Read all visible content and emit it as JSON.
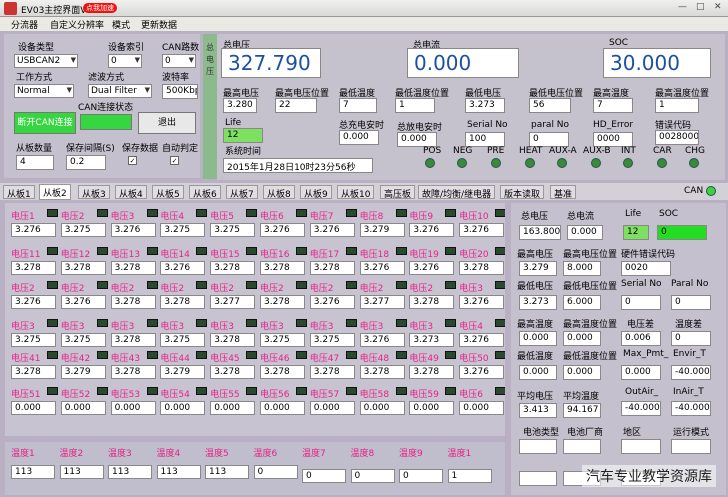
{
  "window": {
    "title": "EV03主控界面V1.5",
    "badge": "点我加速"
  },
  "menu": [
    "分流器",
    "自定义分辨率",
    "模式",
    "更新数据"
  ],
  "config": {
    "device_type_label": "设备类型",
    "device_type": "USBCAN2",
    "device_index_label": "设备索引",
    "device_index": "0",
    "can_channel_label": "CAN路数",
    "can_channel": "0",
    "work_mode_label": "工作方式",
    "work_mode": "Normal",
    "filter_label": "滤波方式",
    "filter": "Dual Filter",
    "baud_label": "波特率",
    "baud": "500Kbp",
    "can_state_label": "CAN连接状态",
    "open_btn": "断开CAN连接",
    "exit_btn": "退出",
    "slave_count_label": "从板数量",
    "slave_count": "4",
    "save_interval_label": "保存间隔(S)",
    "save_interval": "0.2",
    "save_data_label": "保存数据",
    "auto_judge_label": "自动判定"
  },
  "side_strip": [
    "总",
    "电",
    "压"
  ],
  "summary": {
    "voltage_label": "总电压",
    "voltage": "327.790",
    "current_label": "总电流",
    "current": "0.000",
    "soc_label": "SOC",
    "soc": "30.000"
  },
  "stats": [
    {
      "label": "最高电压",
      "value": "3.280"
    },
    {
      "label": "最高电压位置",
      "value": "22"
    },
    {
      "label": "最低温度",
      "value": "7"
    },
    {
      "label": "最低温度位置",
      "value": "1"
    },
    {
      "label": "最低电压",
      "value": "3.273"
    },
    {
      "label": "最低电压位置",
      "value": "56"
    },
    {
      "label": "最高温度",
      "value": "7"
    },
    {
      "label": "最高温度位置",
      "value": "1"
    }
  ],
  "row2": {
    "life_label": "Life",
    "life": "12",
    "charge_ah_label": "总充电安时",
    "charge_ah": "0.000",
    "discharge_ah_label": "总放电安时",
    "discharge_ah": "0.000",
    "serial_label": "Serial No",
    "serial": "100",
    "paral_label": "paral No",
    "paral": "0",
    "hd_error_label": "HD_Error",
    "hd_error": "0000",
    "err_code_label": "错误代码",
    "err_code": "0028000"
  },
  "system_time_label": "系统时间",
  "system_time": "2015年1月28日10时23分56秒",
  "lamps": [
    "POS",
    "NEG",
    "PRE",
    "HEAT",
    "AUX-A",
    "AUX-B",
    "INT",
    "CAR",
    "CHG"
  ],
  "tabs": [
    "从板1",
    "从板2",
    "从板3",
    "从板4",
    "从板5",
    "从板6",
    "从板7",
    "从板8",
    "从板9",
    "从板10",
    "高压板",
    "故障/均衡/继电器",
    "版本读取",
    "基准"
  ],
  "can_label": "CAN",
  "cells": [
    {
      "labels": [
        "电压1",
        "电压2",
        "电压3",
        "电压4",
        "电压5",
        "电压6",
        "电压7",
        "电压8",
        "电压9",
        "电压10"
      ],
      "values": [
        "3.276",
        "3.275",
        "3.276",
        "3.275",
        "3.275",
        "3.276",
        "3.276",
        "3.279",
        "3.276",
        "3.276"
      ]
    },
    {
      "labels": [
        "电压11",
        "电压12",
        "电压13",
        "电压14",
        "电压15",
        "电压16",
        "电压17",
        "电压18",
        "电压19",
        "电压20"
      ],
      "values": [
        "3.278",
        "3.278",
        "3.278",
        "3.276",
        "3.278",
        "3.278",
        "3.278",
        "3.276",
        "3.276",
        "3.278"
      ]
    },
    {
      "labels": [
        "电压2",
        "电压2",
        "电压2",
        "电压2",
        "电压2",
        "电压2",
        "电压2",
        "电压2",
        "电压2",
        "电压3"
      ],
      "values": [
        "3.276",
        "3.276",
        "3.278",
        "3.278",
        "3.277",
        "3.278",
        "3.276",
        "3.277",
        "3.278",
        "3.276"
      ]
    },
    {
      "labels": [
        "电压3",
        "电压3",
        "电压3",
        "电压3",
        "电压3",
        "电压3",
        "电压3",
        "电压3",
        "电压3",
        "电压4"
      ],
      "values": [
        "3.275",
        "3.275",
        "3.278",
        "3.275",
        "3.278",
        "3.275",
        "3.275",
        "3.276",
        "3.273",
        "3.276"
      ]
    },
    {
      "labels": [
        "电压41",
        "电压42",
        "电压43",
        "电压44",
        "电压45",
        "电压46",
        "电压47",
        "电压48",
        "电压49",
        "电压50"
      ],
      "values": [
        "3.278",
        "3.279",
        "3.278",
        "3.279",
        "3.278",
        "3.278",
        "3.278",
        "3.278",
        "3.278",
        "3.276"
      ]
    },
    {
      "labels": [
        "电压51",
        "电压52",
        "电压53",
        "电压54",
        "电压55",
        "电压56",
        "电压57",
        "电压58",
        "电压59",
        "电压6"
      ],
      "values": [
        "0.000",
        "0.000",
        "0.000",
        "0.000",
        "0.000",
        "0.000",
        "0.000",
        "0.000",
        "0.000",
        "0.000"
      ]
    }
  ],
  "temps": {
    "labels": [
      "温度1",
      "温度2",
      "温度3",
      "温度4",
      "温度5",
      "温度6",
      "温度7",
      "温度8",
      "温度9",
      "温度1"
    ],
    "values": [
      "113",
      "113",
      "113",
      "113",
      "113",
      "0",
      "0",
      "0",
      "0",
      "1"
    ]
  },
  "right": {
    "total_v_label": "总电压",
    "total_v": "163.800",
    "total_i_label": "总电流",
    "total_i": "0.000",
    "life_label": "Life",
    "life": "12",
    "soc_label": "SOC",
    "soc": "0",
    "max_v_label": "最高电压",
    "max_v": "3.279",
    "max_v_pos_label": "最高电压位置",
    "max_v_pos": "8.000",
    "hw_err_label": "硬件错误代码",
    "hw_err": "0020",
    "min_v_label": "最低电压",
    "min_v": "3.273",
    "min_v_pos_label": "最低电压位置",
    "min_v_pos": "6.000",
    "serial_label": "Serial No",
    "serial": "0",
    "paral_label": "Paral No",
    "paral": "0",
    "max_t_label": "最高温度",
    "max_t": "0.000",
    "max_t_pos_label": "最高温度位置",
    "max_t_pos": "0.000",
    "vdiff_label": "电压差",
    "vdiff": "0.006",
    "tdiff_label": "温度差",
    "tdiff": "0",
    "min_t_label": "最低温度",
    "min_t": "0.000",
    "min_t_pos_label": "最低温度位置",
    "min_t_pos": "0.000",
    "max_pmt_label": "Max_Pmt_",
    "max_pmt": "0.000",
    "envir_label": "Envir_T",
    "envir": "-40.000",
    "avg_v_label": "平均电压",
    "avg_v": "3.413",
    "avg_t_label": "平均温度",
    "avg_t": "94.167",
    "outair_label": "OutAir_",
    "outair": "-40.000",
    "inair_label": "InAir_T",
    "inair": "-40.000",
    "cell_type_label": "电池类型",
    "cell_vendor_label": "电池厂商",
    "region_label": "地区",
    "run_mode_label": "运行模式"
  },
  "watermark": "汽车专业教学资源库"
}
